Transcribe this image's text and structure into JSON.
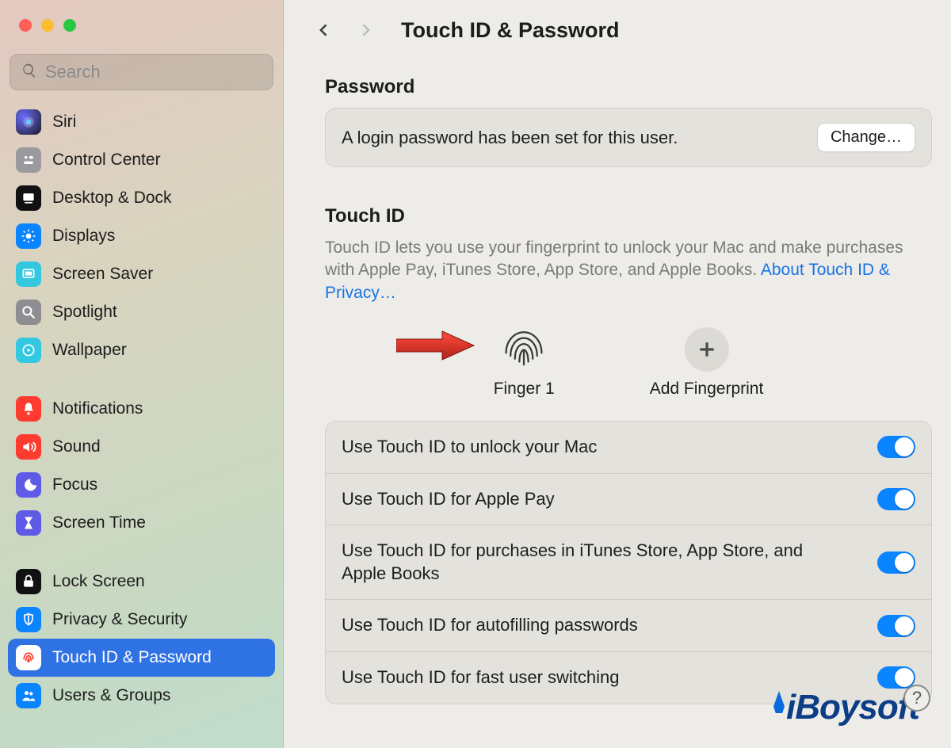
{
  "window": {
    "title": "Touch ID & Password"
  },
  "search": {
    "placeholder": "Search"
  },
  "sidebar": {
    "items": [
      {
        "label": "Siri",
        "icon": "siri"
      },
      {
        "label": "Control Center",
        "icon": "cc"
      },
      {
        "label": "Desktop & Dock",
        "icon": "dock"
      },
      {
        "label": "Displays",
        "icon": "displays"
      },
      {
        "label": "Screen Saver",
        "icon": "ss"
      },
      {
        "label": "Spotlight",
        "icon": "spot"
      },
      {
        "label": "Wallpaper",
        "icon": "wall"
      },
      {
        "label": "Notifications",
        "icon": "notif"
      },
      {
        "label": "Sound",
        "icon": "sound"
      },
      {
        "label": "Focus",
        "icon": "focus"
      },
      {
        "label": "Screen Time",
        "icon": "stime"
      },
      {
        "label": "Lock Screen",
        "icon": "lock"
      },
      {
        "label": "Privacy & Security",
        "icon": "priv"
      },
      {
        "label": "Touch ID & Password",
        "icon": "tid"
      },
      {
        "label": "Users & Groups",
        "icon": "users"
      }
    ],
    "selected_index": 13
  },
  "password": {
    "section_title": "Password",
    "status": "A login password has been set for this user.",
    "change_label": "Change…"
  },
  "touchid": {
    "section_title": "Touch ID",
    "description": "Touch ID lets you use your fingerprint to unlock your Mac and make purchases with Apple Pay, iTunes Store, App Store, and Apple Books. ",
    "link_label": "About Touch ID & Privacy…",
    "fingerprints": [
      {
        "label": "Finger 1",
        "type": "print"
      },
      {
        "label": "Add Fingerprint",
        "type": "add"
      }
    ],
    "options": [
      {
        "label": "Use Touch ID to unlock your Mac",
        "on": true
      },
      {
        "label": "Use Touch ID for Apple Pay",
        "on": true
      },
      {
        "label": "Use Touch ID for purchases in iTunes Store, App Store, and Apple Books",
        "on": true
      },
      {
        "label": "Use Touch ID for autofilling passwords",
        "on": true
      },
      {
        "label": "Use Touch ID for fast user switching",
        "on": true
      }
    ]
  },
  "help_label": "?",
  "watermark": "iBoysoft",
  "colors": {
    "accent": "#0a84ff",
    "selected": "#2f72e3"
  }
}
